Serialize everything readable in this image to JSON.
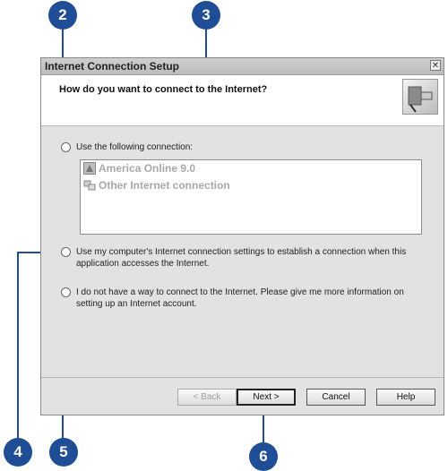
{
  "callouts": [
    "2",
    "3",
    "4",
    "5",
    "6"
  ],
  "dialog": {
    "title": "Internet Connection Setup",
    "close_glyph": "✕",
    "question": "How do you want to connect to the Internet?",
    "options": [
      {
        "label": "Use the following connection:"
      },
      {
        "label": "Use my computer's Internet connection settings to establish a connection when this application accesses the Internet."
      },
      {
        "label": "I do not have a way to connect to the Internet. Please give me more information on setting up an Internet account."
      }
    ],
    "connections": [
      "America Online 9.0",
      "Other Internet connection"
    ],
    "buttons": {
      "back": "< Back",
      "next": "Next >",
      "cancel": "Cancel",
      "help": "Help"
    }
  },
  "colors": {
    "callout": "#1f4e96",
    "dialog_bg": "#e2e2e2"
  }
}
